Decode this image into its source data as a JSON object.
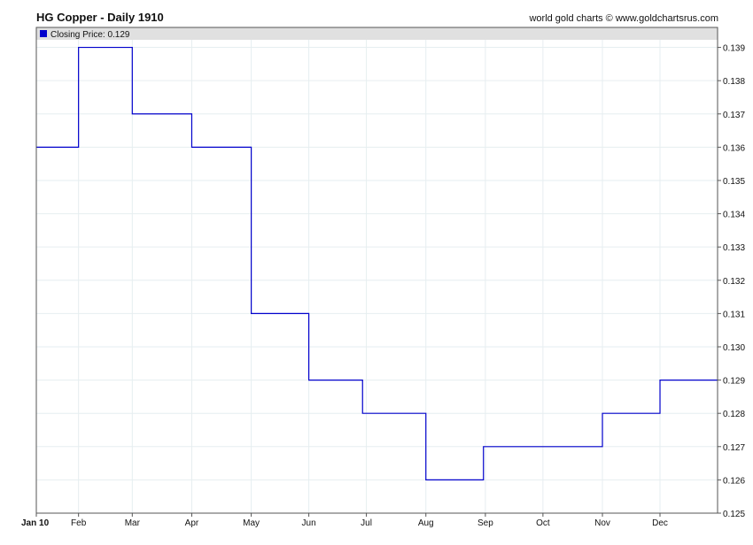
{
  "header": {
    "title": "HG Copper - Daily 1910",
    "credit": "world gold charts © www.goldchartsrus.com"
  },
  "colors": {
    "line": "#0000cc",
    "legend_band": "#e0e0e0",
    "grid": "#e6eef0"
  },
  "chart_data": {
    "type": "line",
    "legend": "Closing Price: 0.129",
    "x_ticks": [
      "Jan 10",
      "Feb",
      "Mar",
      "Apr",
      "May",
      "Jun",
      "Jul",
      "Aug",
      "Sep",
      "Oct",
      "Nov",
      "Dec"
    ],
    "y_ticks": [
      "0.125",
      "0.126",
      "0.127",
      "0.128",
      "0.129",
      "0.130",
      "0.131",
      "0.132",
      "0.133",
      "0.134",
      "0.135",
      "0.136",
      "0.137",
      "0.138",
      "0.139"
    ],
    "ylim": [
      0.125,
      0.1396
    ],
    "xlim": [
      "1910-01-10",
      "1910-12-31"
    ],
    "series": [
      {
        "step": "post",
        "points": [
          {
            "x": "1910-01-10",
            "y": 0.136
          },
          {
            "x": "1910-02-01",
            "y": 0.139
          },
          {
            "x": "1910-03-01",
            "y": 0.137
          },
          {
            "x": "1910-04-01",
            "y": 0.136
          },
          {
            "x": "1910-05-02",
            "y": 0.131
          },
          {
            "x": "1910-06-01",
            "y": 0.129
          },
          {
            "x": "1910-06-29",
            "y": 0.128
          },
          {
            "x": "1910-08-01",
            "y": 0.126
          },
          {
            "x": "1910-08-31",
            "y": 0.127
          },
          {
            "x": "1910-11-01",
            "y": 0.128
          },
          {
            "x": "1910-12-01",
            "y": 0.129
          },
          {
            "x": "1910-12-31",
            "y": 0.129
          }
        ]
      }
    ]
  }
}
